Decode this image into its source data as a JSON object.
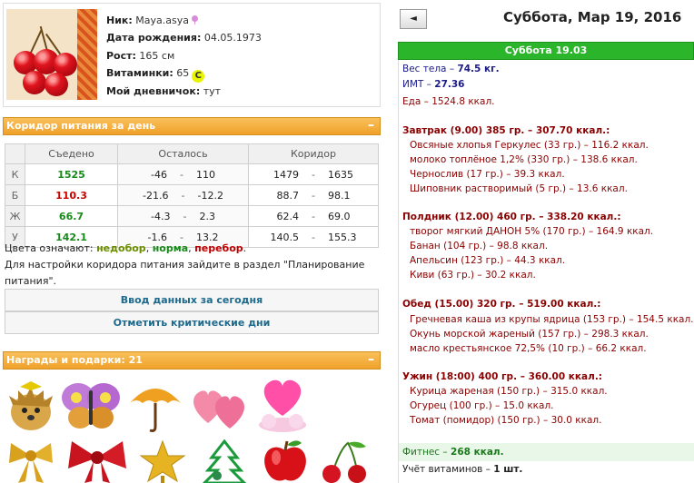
{
  "profile": {
    "nick_label": "Ник:",
    "nick": "Maya.asya",
    "birth_label": "Дата рождения:",
    "birth": "04.05.1973",
    "height_label": "Рост:",
    "height": "165 см",
    "vit_label": "Витаминки:",
    "vit": "65",
    "vit_icon": "C",
    "diary_label": "Мой дневничок:",
    "diary": "тут"
  },
  "corridor": {
    "title": "Коридор питания за день",
    "collapse": "–",
    "headers": [
      "",
      "Съедено",
      "Осталось",
      "Коридор"
    ],
    "rows": [
      {
        "k": "К",
        "eaten": "1525",
        "eaten_color": "g",
        "left_a": "-46",
        "left_b": "110",
        "cor_a": "1479",
        "cor_b": "1635"
      },
      {
        "k": "Б",
        "eaten": "110.3",
        "eaten_color": "r",
        "left_a": "-21.6",
        "left_b": "-12.2",
        "cor_a": "88.7",
        "cor_b": "98.1"
      },
      {
        "k": "Ж",
        "eaten": "66.7",
        "eaten_color": "g",
        "left_a": "-4.3",
        "left_b": "2.3",
        "cor_a": "62.4",
        "cor_b": "69.0"
      },
      {
        "k": "У",
        "eaten": "142.1",
        "eaten_color": "g",
        "left_a": "-1.6",
        "left_b": "13.2",
        "cor_a": "140.5",
        "cor_b": "155.3"
      }
    ],
    "dash": "-",
    "legend_prefix": "Цвета означают:",
    "legend_under": "недобор",
    "legend_norm": "норма",
    "legend_over": "перебор",
    "legend_colors": {
      "under": "#6b8e00",
      "norm": "#178a17",
      "over": "#c00000"
    },
    "settings_text": "Для настройки коридора питания зайдите в раздел \"Планирование питания\".",
    "btn_today": "Ввод данных за сегодня",
    "btn_critical": "Отметить критические дни"
  },
  "gifts": {
    "title": "Награды и подарки: 21",
    "collapse": "–"
  },
  "diary": {
    "back": "◄",
    "date": "Суббота, Мар 19, 2016",
    "header": "Суббота 19.03",
    "weight_label": "Вес тела –",
    "weight": "74.5 кг.",
    "bmi_label": "ИМТ –",
    "bmi": "27.36",
    "food": "Еда – 1524.8 ккал.",
    "meals": [
      {
        "title": "Завтрак (9.00) 385 гр. – 307.70 ккал.:",
        "items": [
          "Овсяные хлопья Геркулес (33 гр.) – 116.2 ккал.",
          "молоко топлёное 1,2% (330 гр.) – 138.6 ккал.",
          "Чернослив (17 гр.) – 39.3 ккал.",
          "Шиповник растворимый (5 гр.) – 13.6 ккал."
        ]
      },
      {
        "title": "Полдник (12.00) 460 гр. – 338.20 ккал.:",
        "items": [
          "творог мягкий ДАНОН 5% (170 гр.) – 164.9 ккал.",
          "Банан (104 гр.) – 98.8 ккал.",
          "Апельсин (123 гр.) – 44.3 ккал.",
          "Киви (63 гр.) – 30.2 ккал."
        ]
      },
      {
        "title": "Обед (15.00) 320 гр. – 519.00 ккал.:",
        "items": [
          "Гречневая каша из крупы ядрица (153 гр.) – 154.5 ккал.",
          "Окунь морской жареный (157 гр.) – 298.3 ккал.",
          "масло крестьянское 72,5% (10 гр.) – 66.2 ккал."
        ]
      },
      {
        "title": "Ужин (18:00) 400 гр. – 360.00 ккал.:",
        "items": [
          "Курица жареная (150 гр.) – 315.0 ккал.",
          "Огурец (100 гр.) – 15.0 ккал.",
          "Томат (помидор) (150 гр.) – 30.0 ккал."
        ]
      }
    ],
    "fitness_label": "Фитнес –",
    "fitness": "268 ккал.",
    "vit_label": "Учёт витаминов –",
    "vit": "1 шт."
  }
}
